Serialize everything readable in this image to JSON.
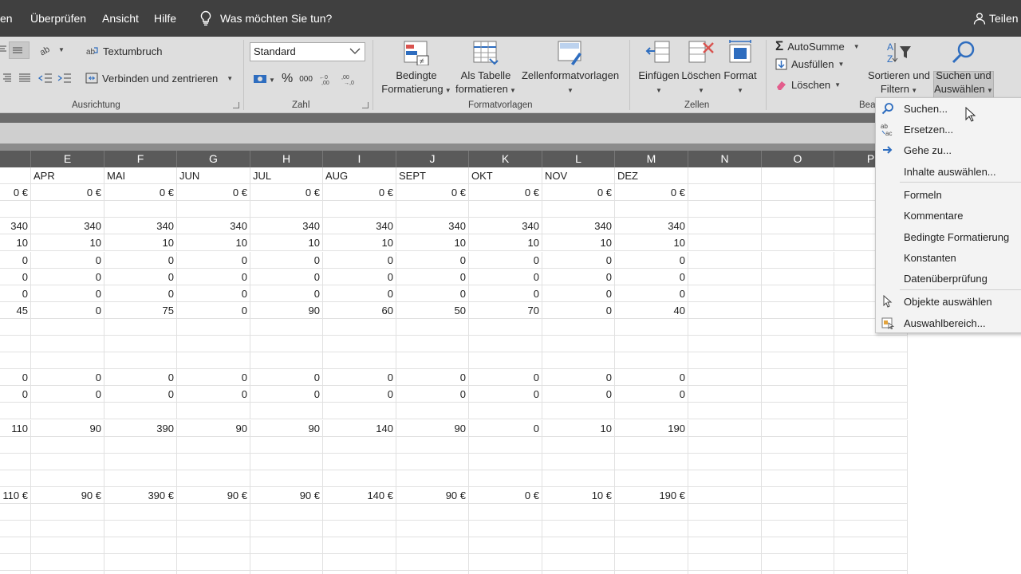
{
  "menubar": {
    "items": [
      "en",
      "Überprüfen",
      "Ansicht",
      "Hilfe"
    ],
    "tell_me": "Was möchten Sie tun?",
    "share": "Teilen"
  },
  "ribbon": {
    "alignment": {
      "wrap_text": "Textumbruch",
      "merge_center": "Verbinden und zentrieren",
      "label": "Ausrichtung"
    },
    "number": {
      "format_value": "Standard",
      "percent": "%",
      "thousands": "000",
      "label": "Zahl"
    },
    "styles": {
      "conditional": [
        "Bedingte",
        "Formatierung"
      ],
      "as_table": [
        "Als Tabelle",
        "formatieren"
      ],
      "cell_styles": "Zellenformatvorlagen",
      "label": "Formatvorlagen"
    },
    "cells": {
      "insert": "Einfügen",
      "delete": "Löschen",
      "format": "Format",
      "label": "Zellen"
    },
    "editing": {
      "autosum": "AutoSumme",
      "fill": "Ausfüllen",
      "clear": "Löschen",
      "sort_filter": [
        "Sortieren und",
        "Filtern"
      ],
      "find_select": [
        "Suchen und",
        "Auswählen"
      ],
      "label_partial": "Bea"
    }
  },
  "grid": {
    "columns": [
      "E",
      "F",
      "G",
      "H",
      "I",
      "J",
      "K",
      "L",
      "M",
      "N",
      "O",
      "P"
    ],
    "month_headers": [
      "APR",
      "MAI",
      "JUN",
      "JUL",
      "AUG",
      "SEPT",
      "OKT",
      "NOV",
      "DEZ"
    ],
    "rows": [
      [
        "0 €",
        "0 €",
        "0 €",
        "0 €",
        "0 €",
        "0 €",
        "0 €",
        "0 €",
        "0 €",
        "0 €"
      ],
      [],
      [
        "340",
        "340",
        "340",
        "340",
        "340",
        "340",
        "340",
        "340",
        "340",
        "340"
      ],
      [
        "10",
        "10",
        "10",
        "10",
        "10",
        "10",
        "10",
        "10",
        "10",
        "10"
      ],
      [
        "0",
        "0",
        "0",
        "0",
        "0",
        "0",
        "0",
        "0",
        "0",
        "0"
      ],
      [
        "0",
        "0",
        "0",
        "0",
        "0",
        "0",
        "0",
        "0",
        "0",
        "0"
      ],
      [
        "0",
        "0",
        "0",
        "0",
        "0",
        "0",
        "0",
        "0",
        "0",
        "0"
      ],
      [
        "45",
        "0",
        "75",
        "0",
        "90",
        "60",
        "50",
        "70",
        "0",
        "40"
      ],
      [],
      [],
      [],
      [
        "0",
        "0",
        "0",
        "0",
        "0",
        "0",
        "0",
        "0",
        "0",
        "0"
      ],
      [
        "0",
        "0",
        "0",
        "0",
        "0",
        "0",
        "0",
        "0",
        "0",
        "0"
      ],
      [],
      [
        "110",
        "90",
        "390",
        "90",
        "90",
        "140",
        "90",
        "0",
        "10",
        "190"
      ],
      [],
      [],
      [],
      [
        "110 €",
        "90 €",
        "390 €",
        "90 €",
        "90 €",
        "140 €",
        "90 €",
        "0 €",
        "10 €",
        "190 €"
      ],
      [],
      [],
      [],
      [],
      []
    ]
  },
  "dropdown": {
    "items": [
      {
        "label": "Suchen...",
        "icon": "search-icon"
      },
      {
        "label": "Ersetzen...",
        "icon": "replace-icon"
      },
      {
        "label": "Gehe zu...",
        "icon": "arrow-right-icon"
      },
      {
        "label": "Inhalte auswählen...",
        "icon": ""
      },
      {
        "label": "Formeln",
        "icon": ""
      },
      {
        "label": "Kommentare",
        "icon": ""
      },
      {
        "label": "Bedingte Formatierung",
        "icon": ""
      },
      {
        "label": "Konstanten",
        "icon": ""
      },
      {
        "label": "Datenüberprüfung",
        "icon": ""
      },
      {
        "label": "Objekte auswählen",
        "icon": "pointer-icon"
      },
      {
        "label": "Auswahlbereich...",
        "icon": "selection-pane-icon"
      }
    ]
  },
  "colors": {
    "menubar": "#404040",
    "ribbon": "#dedede",
    "col_header": "#5a5a5a",
    "accent": "#2e6dbf"
  }
}
